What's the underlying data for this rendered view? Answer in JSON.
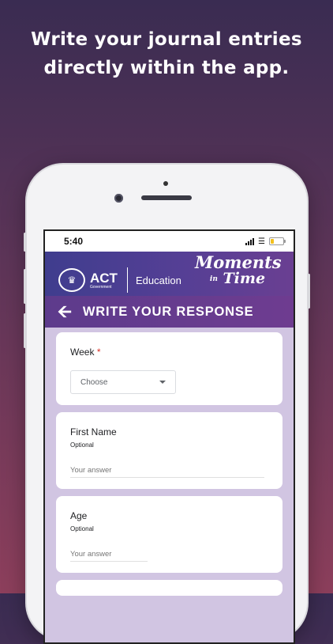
{
  "headline": {
    "line1": "Write your journal entries",
    "line2": "directly within the app."
  },
  "status_bar": {
    "time": "5:40",
    "battery_level": 0.25,
    "colors": {
      "battery": "#f2c01e"
    }
  },
  "app_header": {
    "org_short": "ACT",
    "org_sub": "Government",
    "department": "Education",
    "brand_line1": "Moments",
    "brand_in": "in",
    "brand_line2": "Time"
  },
  "title_bar": {
    "back_icon": "arrow-left-icon",
    "title": "WRITE YOUR RESPONSE"
  },
  "form": {
    "week": {
      "label": "Week",
      "required_mark": "*",
      "selected": "Choose"
    },
    "first_name": {
      "label": "First Name",
      "help": "Optional",
      "placeholder": "Your answer"
    },
    "age": {
      "label": "Age",
      "help": "Optional",
      "placeholder": "Your answer"
    }
  },
  "colors": {
    "header_start": "#3f3d8e",
    "header_end": "#6a3f92",
    "form_background": "#d1c5e2",
    "required": "#d93025"
  }
}
